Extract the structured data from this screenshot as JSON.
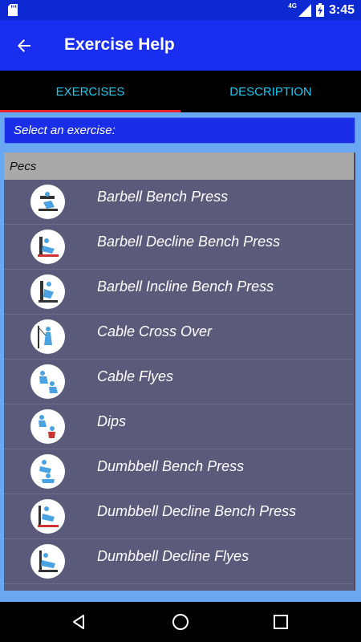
{
  "status_bar": {
    "time": "3:45",
    "network": "4G"
  },
  "app_bar": {
    "title": "Exercise Help",
    "back_icon": "arrow-back-icon"
  },
  "tabs": [
    {
      "label": "EXERCISES",
      "selected": true
    },
    {
      "label": "DESCRIPTION",
      "selected": false
    }
  ],
  "selector": {
    "label": "Select an exercise:"
  },
  "group": {
    "label": "Pecs"
  },
  "exercises": [
    {
      "label": "Barbell Bench Press"
    },
    {
      "label": "Barbell Decline Bench Press"
    },
    {
      "label": "Barbell Incline Bench Press"
    },
    {
      "label": "Cable Cross Over"
    },
    {
      "label": "Cable Flyes"
    },
    {
      "label": "Dips"
    },
    {
      "label": "Dumbbell Bench Press"
    },
    {
      "label": "Dumbbell Decline Bench Press"
    },
    {
      "label": "Dumbbell Decline Flyes"
    }
  ],
  "colors": {
    "status_bar": "#0d29d1",
    "app_bar": "#1a2ef0",
    "tab_text": "#1ec8f0",
    "tab_indicator": "#e8202a",
    "content_bg": "#69a8f0",
    "list_bg": "#5a5a7a",
    "group_header": "#a9a9a9"
  }
}
